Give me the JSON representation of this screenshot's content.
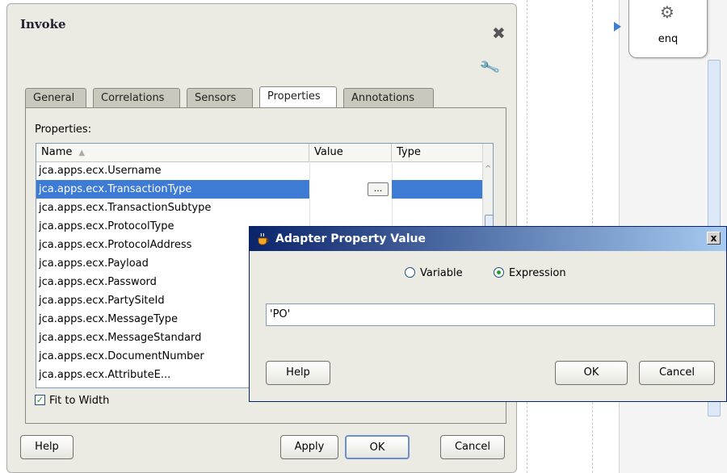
{
  "invoke_dialog": {
    "title": "Invoke",
    "tabs": [
      {
        "label": "General"
      },
      {
        "label": "Correlations"
      },
      {
        "label": "Sensors"
      },
      {
        "label": "Properties",
        "active": true
      },
      {
        "label": "Annotations"
      }
    ],
    "properties_label": "Properties:",
    "table": {
      "columns": [
        "Name",
        "Value",
        "Type"
      ],
      "rows": [
        {
          "name": "jca.apps.ecx.Username"
        },
        {
          "name": "jca.apps.ecx.TransactionType",
          "selected": true,
          "value_button": "..."
        },
        {
          "name": "jca.apps.ecx.TransactionSubtype"
        },
        {
          "name": "jca.apps.ecx.ProtocolType"
        },
        {
          "name": "jca.apps.ecx.ProtocolAddress"
        },
        {
          "name": "jca.apps.ecx.Payload"
        },
        {
          "name": "jca.apps.ecx.Password"
        },
        {
          "name": "jca.apps.ecx.PartySiteId"
        },
        {
          "name": "jca.apps.ecx.MessageType"
        },
        {
          "name": "jca.apps.ecx.MessageStandard"
        },
        {
          "name": "jca.apps.ecx.DocumentNumber"
        },
        {
          "name": "jca.apps.ecx.AttributeE..."
        }
      ]
    },
    "fit_to_width_label": "Fit to Width",
    "fit_to_width_checked": true,
    "buttons": {
      "help": "Help",
      "apply": "Apply",
      "ok": "OK",
      "cancel": "Cancel"
    }
  },
  "adapter_dialog": {
    "title": "Adapter Property Value",
    "close_label": "x",
    "radio_variable": "Variable",
    "radio_expression": "Expression",
    "selected_option": "Expression",
    "expression_value": "'PO'",
    "buttons": {
      "help": "Help",
      "ok": "OK",
      "cancel": "Cancel"
    }
  },
  "canvas": {
    "node_label": "enq"
  },
  "colors": {
    "selection": "#3d7bd5",
    "title_bar_start": "#0a246a",
    "title_bar_end": "#a6caf0"
  }
}
